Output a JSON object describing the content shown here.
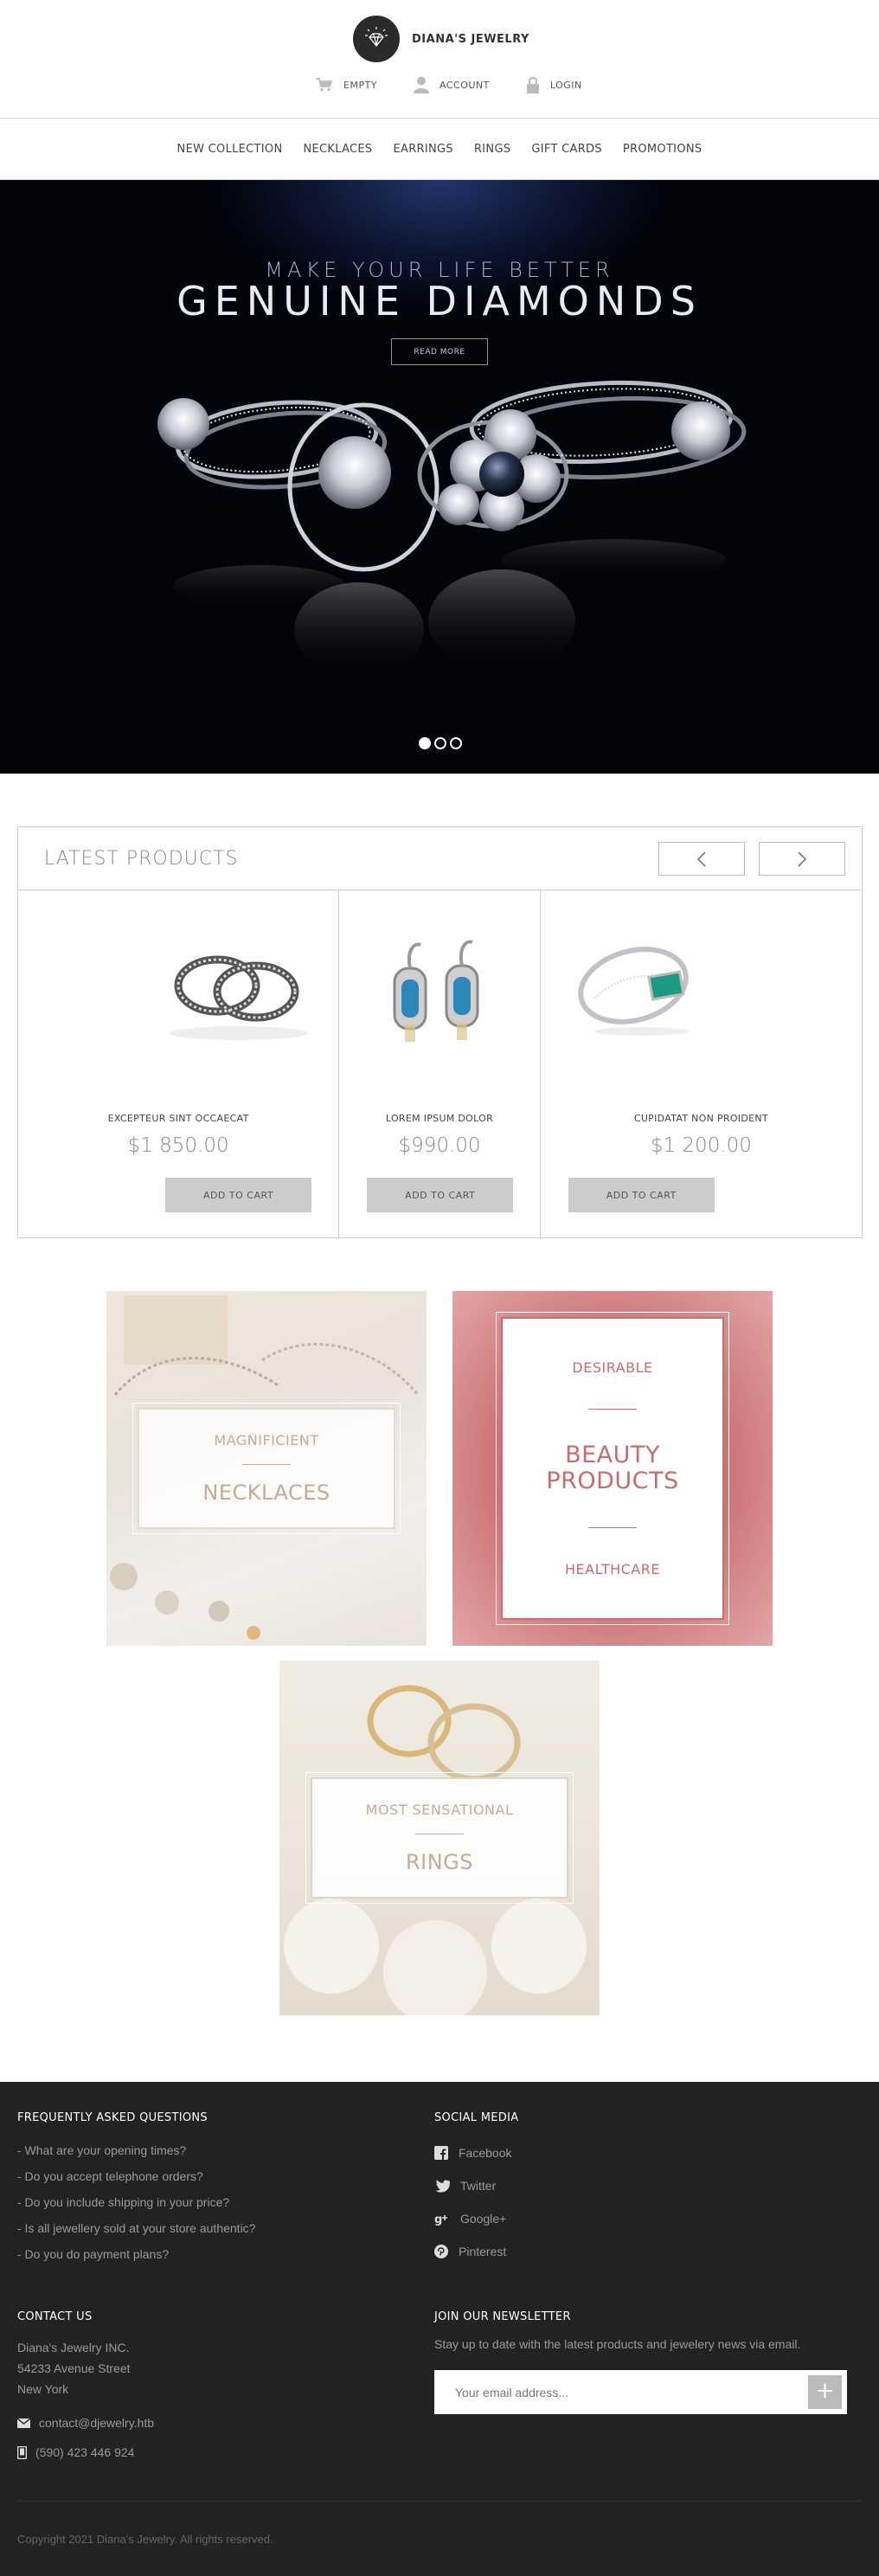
{
  "header": {
    "brand": "DIANA'S JEWELRY",
    "links": [
      {
        "label": "EMPTY",
        "icon": "cart-icon"
      },
      {
        "label": "ACCOUNT",
        "icon": "user-icon"
      },
      {
        "label": "LOGIN",
        "icon": "lock-icon"
      }
    ]
  },
  "nav": [
    "NEW COLLECTION",
    "NECKLACES",
    "EARRINGS",
    "RINGS",
    "GIFT CARDS",
    "PROMOTIONS"
  ],
  "hero": {
    "subtitle": "MAKE YOUR LIFE BETTER",
    "title": "GENUINE DIAMONDS",
    "button": "READ MORE",
    "slides": 3,
    "active_slide": 1
  },
  "latest": {
    "title": "LATEST PRODUCTS",
    "products": [
      {
        "name": "EXCEPTEUR SINT OCCAECAT",
        "price": "$1 850.00",
        "button": "ADD TO CART"
      },
      {
        "name": "LOREM IPSUM DOLOR",
        "price": "$990.00",
        "button": "ADD TO CART"
      },
      {
        "name": "CUPIDATAT NON PROIDENT",
        "price": "$1 200.00",
        "button": "ADD TO CART"
      }
    ]
  },
  "banners": {
    "necklaces": {
      "top": "MAGNIFICIENT",
      "bottom": "NECKLACES"
    },
    "beauty": {
      "top": "DESIRABLE",
      "middle": "BEAUTY PRODUCTS",
      "bottom": "HEALTHCARE"
    },
    "rings": {
      "top": "MOST SENSATIONAL",
      "bottom": "RINGS"
    }
  },
  "footer": {
    "faq": {
      "title": "FREQUENTLY ASKED QUESTIONS",
      "items": [
        "- What are your opening times?",
        "- Do you accept telephone orders?",
        "- Do you include shipping in your price?",
        "- Is all jewellery sold at your store authentic?",
        "- Do you do payment plans?"
      ]
    },
    "social": {
      "title": "SOCIAL MEDIA",
      "items": [
        {
          "label": "Facebook",
          "icon": "facebook-icon"
        },
        {
          "label": "Twitter",
          "icon": "twitter-icon"
        },
        {
          "label": "Google+",
          "icon": "google-plus-icon"
        },
        {
          "label": "Pinterest",
          "icon": "pinterest-icon"
        }
      ]
    },
    "contact": {
      "title": "CONTACT US",
      "company": "Diana's Jewelry INC.",
      "street": "54233 Avenue Street",
      "city": "New York",
      "email": "contact@djewelry.htb",
      "phone": "(590) 423 446 924"
    },
    "newsletter": {
      "title": "JOIN OUR NEWSLETTER",
      "text": "Stay up to date with the latest products and jewelery news via email.",
      "placeholder": "Your email address...",
      "button": "+"
    },
    "copyright": "Copyright 2021 Diana's Jewelry. All rights reserved."
  }
}
